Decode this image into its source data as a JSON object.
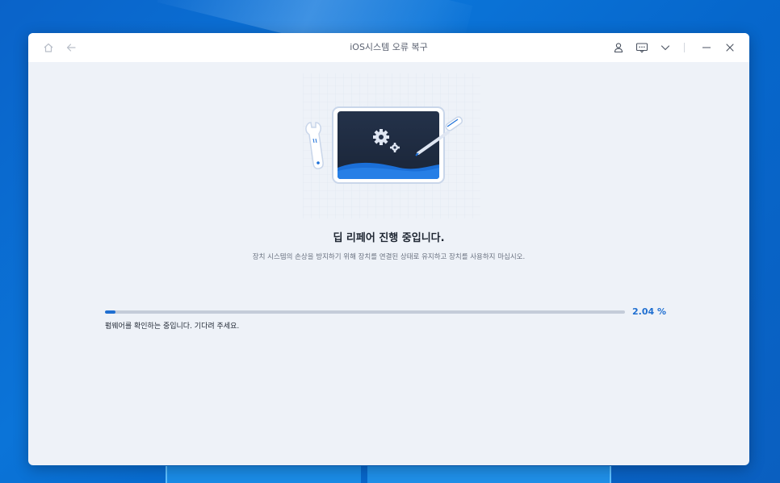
{
  "window": {
    "title": "iOS시스템 오류 복구"
  },
  "titlebar_icons": {
    "home": "home-icon",
    "back": "back-arrow-icon",
    "account": "user-icon",
    "feedback": "chat-icon",
    "menu": "chevron-down-icon",
    "minimize": "minimize-icon",
    "close": "close-icon"
  },
  "main": {
    "heading": "딥 리페어 진행 중입니다.",
    "subtext": "장치 시스템의 손상을 방지하기 위해 장치를 연결된 상태로 유지하고 장치를 사용하지 마십시오."
  },
  "progress": {
    "value": 2.04,
    "percent_label": "2.04 %",
    "status": "펌웨어를 확인하는 중입니다. 기다려 주세요."
  },
  "colors": {
    "accent": "#1f6fd1",
    "window_bg": "#eef2f8",
    "titlebar_bg": "#ffffff"
  }
}
